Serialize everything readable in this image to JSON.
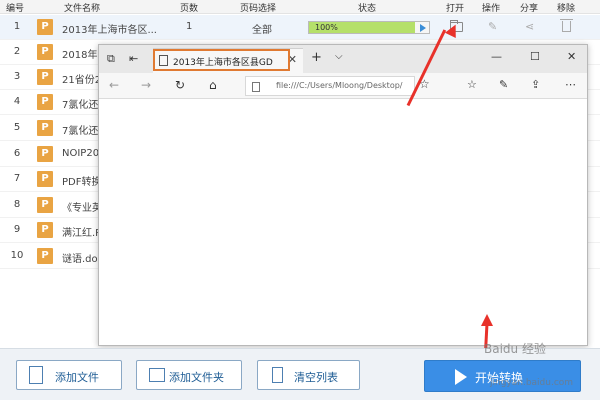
{
  "header": {
    "cols": [
      "编号",
      "文件名称",
      "页数",
      "页码选择",
      "状态",
      "打开",
      "操作",
      "分享",
      "移除"
    ]
  },
  "rows": [
    {
      "num": "1",
      "icon": "P",
      "name": "2013年上海市各区...",
      "pages": "1",
      "range": "全部",
      "progress": "100%",
      "progress_value": 100
    },
    {
      "num": "2",
      "icon": "P",
      "name": "2018年"
    },
    {
      "num": "3",
      "icon": "P",
      "name": "21省份2"
    },
    {
      "num": "4",
      "icon": "P",
      "name": "7氯化还"
    },
    {
      "num": "5",
      "icon": "P",
      "name": "7氯化还"
    },
    {
      "num": "6",
      "icon": "P",
      "name": "NOIP20"
    },
    {
      "num": "7",
      "icon": "P",
      "name": "PDF转换"
    },
    {
      "num": "8",
      "icon": "P",
      "name": "《专业英"
    },
    {
      "num": "9",
      "icon": "P",
      "name": "满江红.P"
    },
    {
      "num": "10",
      "icon": "P",
      "name": "谜语.doc"
    }
  ],
  "browser": {
    "tab_title": "2013年上海市各区县GD",
    "tab_close": "✕",
    "new_tab": "+",
    "tab_menu": "⌵",
    "minimize": "—",
    "maximize": "☐",
    "close": "✕",
    "url": "file:///C:/Users/Mloong/Desktop/"
  },
  "buttons": {
    "add_file": "添加文件",
    "add_folder": "添加文件夹",
    "clear_list": "清空列表",
    "start_convert": "开始转换"
  },
  "watermark": {
    "text": "Baidu 经验",
    "sub": "jingyan.baidu.com"
  },
  "colors": {
    "accent": "#3a8ee6",
    "progress": "#b5e06a",
    "pdf_icon": "#e9a443",
    "highlight": "#e07a32",
    "arrow": "#e8312a"
  }
}
